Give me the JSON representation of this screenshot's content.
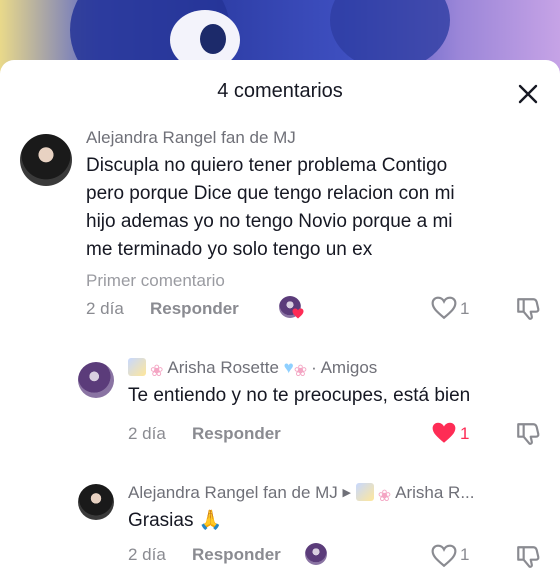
{
  "header": {
    "title": "4 comentarios"
  },
  "comments": [
    {
      "author": "Alejandra Rangel fan de MJ",
      "lines": [
        "Discupla no quiero tener problema Contigo",
        "pero porque Dice que tengo relacion con mi",
        "hijo ademas yo no tengo Novio porque a mi",
        "me terminado yo solo tengo un ex"
      ],
      "tag": "Primer comentario",
      "time": "2 día",
      "reply_label": "Responder",
      "likes": "1",
      "icons": [
        "author-liked-avatar",
        "heart-outline-icon",
        "dislike-icon"
      ]
    }
  ],
  "replies": [
    {
      "author": "Arisha Rosette",
      "suffix": "· Amigos",
      "text": "Te entiendo y no te preocupes, está bien",
      "time": "2 día",
      "reply_label": "Responder",
      "likes": "1",
      "liked": true
    },
    {
      "author": "Alejandra Rangel fan de MJ",
      "reply_to": "Arisha R...",
      "text": "Grasias 🙏",
      "time": "2 día",
      "reply_label": "Responder",
      "likes": "1"
    }
  ],
  "colors": {
    "accent": "#fe2c55",
    "text": "#161823",
    "muted": "#8a8b91"
  }
}
